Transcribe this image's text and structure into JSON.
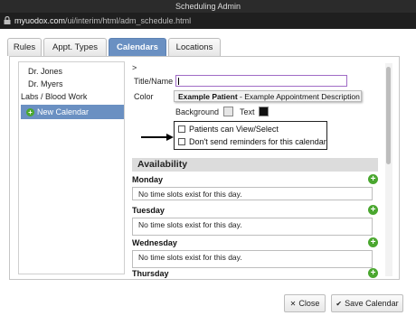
{
  "window": {
    "title": "Scheduling Admin"
  },
  "browser": {
    "url_domain": "myuodox.com",
    "url_path": "/ui/interim/html/adm_schedule.html"
  },
  "tabs": [
    {
      "label": "Rules"
    },
    {
      "label": "Appt. Types"
    },
    {
      "label": "Calendars"
    },
    {
      "label": "Locations"
    }
  ],
  "sidebar": {
    "items": [
      {
        "label": "Dr. Jones"
      },
      {
        "label": "Dr. Myers"
      },
      {
        "label": "Labs / Blood Work"
      },
      {
        "label": "New Calendar"
      }
    ]
  },
  "form": {
    "stray_mark": ">",
    "title_label": "Title/Name",
    "title_value": "",
    "color_label": "Color",
    "tooltip_bold": "Example Patient",
    "tooltip_rest": " - Example Appointment Description",
    "background_label": "Background",
    "text_label": "Text",
    "colors": {
      "background": "#e6e6e6",
      "text": "#111111"
    },
    "checkbox_patients_view": "Patients can View/Select",
    "checkbox_no_reminders": "Don't send reminders for this calendar"
  },
  "availability": {
    "header": "Availability",
    "days": [
      {
        "name": "Monday",
        "message": "No time slots exist for this day."
      },
      {
        "name": "Tuesday",
        "message": "No time slots exist for this day."
      },
      {
        "name": "Wednesday",
        "message": "No time slots exist for this day."
      },
      {
        "name": "Thursday",
        "message": ""
      }
    ]
  },
  "footer": {
    "close_label": "Close",
    "save_label": "Save Calendar"
  },
  "icons": {
    "add": "plus-circle-icon",
    "close": "x-icon",
    "save": "check-icon",
    "lock": "lock-icon",
    "arrow": "arrow-right-icon"
  }
}
